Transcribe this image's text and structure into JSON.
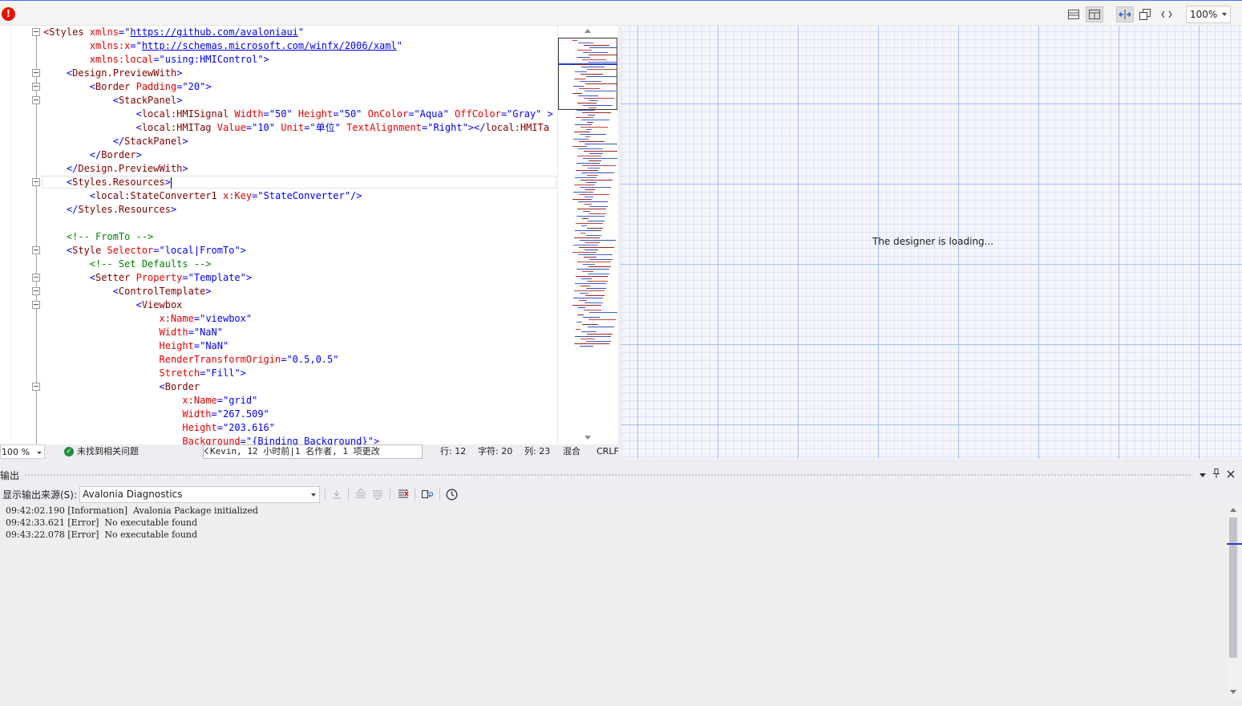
{
  "toolbar": {
    "error_glyph": "!",
    "zoom": "100%",
    "icons": [
      "horizontal-split-icon",
      "vertical-split-icon",
      "swap-panes-icon",
      "collapse-pane-icon",
      "code-view-icon"
    ]
  },
  "editor": {
    "lines": [
      [
        [
          "b",
          "<Styles "
        ],
        [
          "a",
          "xmlns"
        ],
        [
          "p",
          "=\""
        ],
        [
          "u",
          "https://github.com/avaloniaui"
        ],
        [
          "p",
          "\""
        ]
      ],
      [
        [
          "p",
          "        "
        ],
        [
          "a",
          "xmlns:x"
        ],
        [
          "p",
          "=\""
        ],
        [
          "u",
          "http://schemas.microsoft.com/winfx/2006/xaml"
        ],
        [
          "p",
          "\""
        ]
      ],
      [
        [
          "p",
          "        "
        ],
        [
          "a",
          "xmlns:local"
        ],
        [
          "p",
          "=\""
        ],
        [
          "v",
          "using:HMIControl"
        ],
        [
          "p",
          "\">"
        ]
      ],
      [
        [
          "p",
          "    "
        ],
        [
          "p",
          "<"
        ],
        [
          "b",
          "Design.PreviewWith"
        ],
        [
          "p",
          ">"
        ]
      ],
      [
        [
          "p",
          "        "
        ],
        [
          "p",
          "<"
        ],
        [
          "b",
          "Border "
        ],
        [
          "a",
          "Padding"
        ],
        [
          "p",
          "=\""
        ],
        [
          "v",
          "20"
        ],
        [
          "p",
          "\">"
        ]
      ],
      [
        [
          "p",
          "            "
        ],
        [
          "p",
          "<"
        ],
        [
          "b",
          "StackPanel"
        ],
        [
          "p",
          ">"
        ]
      ],
      [
        [
          "p",
          "                "
        ],
        [
          "p",
          "<"
        ],
        [
          "b",
          "local:HMISignal "
        ],
        [
          "a",
          "Width"
        ],
        [
          "p",
          "=\""
        ],
        [
          "v",
          "50"
        ],
        [
          "p",
          "\" "
        ],
        [
          "a",
          "Height"
        ],
        [
          "p",
          "=\""
        ],
        [
          "v",
          "50"
        ],
        [
          "p",
          "\" "
        ],
        [
          "a",
          "OnColor"
        ],
        [
          "p",
          "=\""
        ],
        [
          "v",
          "Aqua"
        ],
        [
          "p",
          "\" "
        ],
        [
          "a",
          "OffColor"
        ],
        [
          "p",
          "=\""
        ],
        [
          "v",
          "Gray"
        ],
        [
          "p",
          "\" >"
        ]
      ],
      [
        [
          "p",
          "                "
        ],
        [
          "p",
          "<"
        ],
        [
          "b",
          "local:HMITag "
        ],
        [
          "a",
          "Value"
        ],
        [
          "p",
          "=\""
        ],
        [
          "v",
          "10"
        ],
        [
          "p",
          "\" "
        ],
        [
          "a",
          "Unit"
        ],
        [
          "p",
          "=\""
        ],
        [
          "v",
          "单位"
        ],
        [
          "p",
          "\" "
        ],
        [
          "a",
          "TextAlignment"
        ],
        [
          "p",
          "=\""
        ],
        [
          "v",
          "Right"
        ],
        [
          "p",
          "\"></"
        ],
        [
          "b",
          "local:HMITa"
        ]
      ],
      [
        [
          "p",
          "            </"
        ],
        [
          "b",
          "StackPanel"
        ],
        [
          "p",
          ">"
        ]
      ],
      [
        [
          "p",
          "        </"
        ],
        [
          "b",
          "Border"
        ],
        [
          "p",
          ">"
        ]
      ],
      [
        [
          "p",
          "    </"
        ],
        [
          "b",
          "Design.PreviewWith"
        ],
        [
          "p",
          ">"
        ]
      ],
      [
        [
          "p",
          "    <"
        ],
        [
          "b",
          "Styles.Resources"
        ],
        [
          "p",
          ">"
        ]
      ],
      [
        [
          "p",
          "        <"
        ],
        [
          "b",
          "local:StateConverter1 "
        ],
        [
          "a",
          "x:Key"
        ],
        [
          "p",
          "=\""
        ],
        [
          "v",
          "StateConverter"
        ],
        [
          "p",
          "\"/>"
        ]
      ],
      [
        [
          "p",
          "    </"
        ],
        [
          "b",
          "Styles.Resources"
        ],
        [
          "p",
          ">"
        ]
      ],
      [],
      [
        [
          "p",
          "    "
        ],
        [
          "c",
          "<!-- FromTo -->"
        ]
      ],
      [
        [
          "p",
          "    <"
        ],
        [
          "b",
          "Style "
        ],
        [
          "a",
          "Selector"
        ],
        [
          "p",
          "=\""
        ],
        [
          "v",
          "local|FromTo"
        ],
        [
          "p",
          "\">"
        ]
      ],
      [
        [
          "p",
          "        "
        ],
        [
          "c",
          "<!-- Set Defaults -->"
        ]
      ],
      [
        [
          "p",
          "        <"
        ],
        [
          "b",
          "Setter "
        ],
        [
          "a",
          "Property"
        ],
        [
          "p",
          "=\""
        ],
        [
          "v",
          "Template"
        ],
        [
          "p",
          "\">"
        ]
      ],
      [
        [
          "p",
          "            <"
        ],
        [
          "b",
          "ControlTemplate"
        ],
        [
          "p",
          ">"
        ]
      ],
      [
        [
          "p",
          "                <"
        ],
        [
          "b",
          "Viewbox"
        ]
      ],
      [
        [
          "p",
          "                    "
        ],
        [
          "a",
          "x:Name"
        ],
        [
          "p",
          "=\""
        ],
        [
          "v",
          "viewbox"
        ],
        [
          "p",
          "\""
        ]
      ],
      [
        [
          "p",
          "                    "
        ],
        [
          "a",
          "Width"
        ],
        [
          "p",
          "=\""
        ],
        [
          "v",
          "NaN"
        ],
        [
          "p",
          "\""
        ]
      ],
      [
        [
          "p",
          "                    "
        ],
        [
          "a",
          "Height"
        ],
        [
          "p",
          "=\""
        ],
        [
          "v",
          "NaN"
        ],
        [
          "p",
          "\""
        ]
      ],
      [
        [
          "p",
          "                    "
        ],
        [
          "a",
          "RenderTransformOrigin"
        ],
        [
          "p",
          "=\""
        ],
        [
          "v",
          "0.5,0.5"
        ],
        [
          "p",
          "\""
        ]
      ],
      [
        [
          "p",
          "                    "
        ],
        [
          "a",
          "Stretch"
        ],
        [
          "p",
          "=\""
        ],
        [
          "v",
          "Fill"
        ],
        [
          "p",
          "\">"
        ]
      ],
      [
        [
          "p",
          "                    <"
        ],
        [
          "b",
          "Border"
        ]
      ],
      [
        [
          "p",
          "                        "
        ],
        [
          "a",
          "x:Name"
        ],
        [
          "p",
          "=\""
        ],
        [
          "v",
          "grid"
        ],
        [
          "p",
          "\""
        ]
      ],
      [
        [
          "p",
          "                        "
        ],
        [
          "a",
          "Width"
        ],
        [
          "p",
          "=\""
        ],
        [
          "v",
          "267.509"
        ],
        [
          "p",
          "\""
        ]
      ],
      [
        [
          "p",
          "                        "
        ],
        [
          "a",
          "Height"
        ],
        [
          "p",
          "=\""
        ],
        [
          "v",
          "203.616"
        ],
        [
          "p",
          "\""
        ]
      ],
      [
        [
          "p",
          "                        "
        ],
        [
          "a",
          "Background"
        ],
        [
          "p",
          "=\""
        ],
        [
          "v",
          "{Binding Background}"
        ],
        [
          "p",
          "\">"
        ]
      ]
    ]
  },
  "status": {
    "zoom": "100 %",
    "issues": "未找到相关问题",
    "git": "Kevin, 12 小时前|1 名作者, 1 项更改",
    "line": "行: 12",
    "char": "字符: 20",
    "col": "列: 23",
    "mode": "混合",
    "eol": "CRLF"
  },
  "designer": {
    "message": "The designer is loading..."
  },
  "output": {
    "title": "输出",
    "source_label": "显示输出来源(S):",
    "source_value": "Avalonia Diagnostics",
    "logs": [
      "09:42:02.190 [Information]  Avalonia Package initialized",
      "09:42:33.621 [Error]  No executable found",
      "09:43:22.078 [Error]  No executable found"
    ]
  }
}
